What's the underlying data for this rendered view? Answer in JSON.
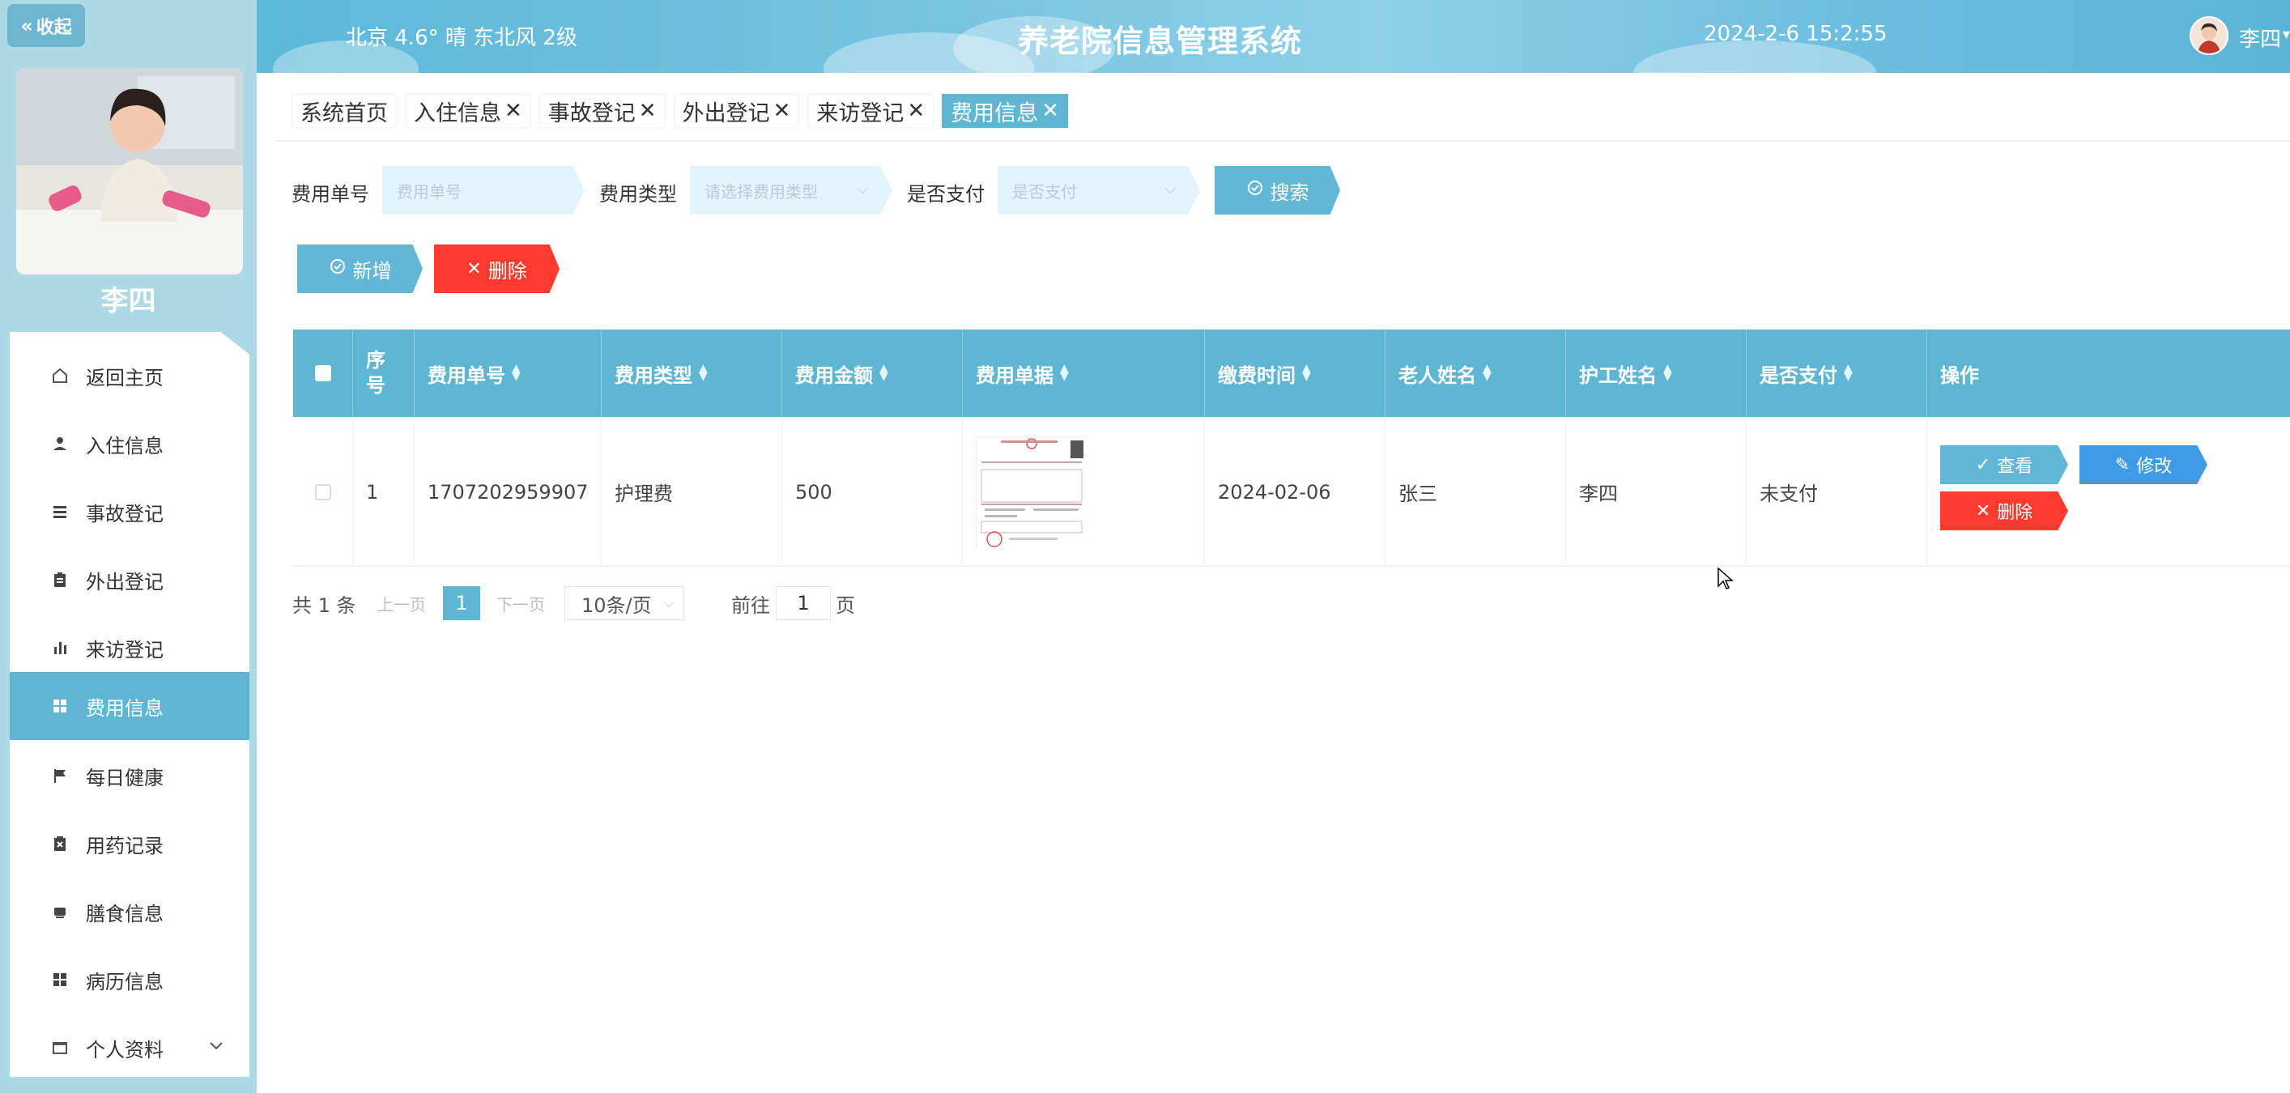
{
  "sidebar": {
    "collapse_label": "收起",
    "user_name": "李四",
    "items": [
      {
        "label": "返回主页",
        "icon": "home-icon"
      },
      {
        "label": "入住信息",
        "icon": "user-icon"
      },
      {
        "label": "事故登记",
        "icon": "list-icon"
      },
      {
        "label": "外出登记",
        "icon": "clipboard-icon"
      },
      {
        "label": "来访登记",
        "icon": "bar-chart-icon"
      },
      {
        "label": "费用信息",
        "icon": "grid-icon",
        "active": true
      },
      {
        "label": "每日健康",
        "icon": "flag-icon"
      },
      {
        "label": "用药记录",
        "icon": "medicine-icon"
      },
      {
        "label": "膳食信息",
        "icon": "meal-icon"
      },
      {
        "label": "病历信息",
        "icon": "grid-icon"
      },
      {
        "label": "个人资料",
        "icon": "wallet-icon"
      }
    ]
  },
  "header": {
    "weather": "北京 4.6° 晴 东北风 2级",
    "title": "养老院信息管理系统",
    "datetime": "2024-2-6 15:2:55",
    "user": "李四"
  },
  "tabs": [
    {
      "label": "系统首页",
      "closable": false
    },
    {
      "label": "入住信息",
      "closable": true
    },
    {
      "label": "事故登记",
      "closable": true
    },
    {
      "label": "外出登记",
      "closable": true
    },
    {
      "label": "来访登记",
      "closable": true
    },
    {
      "label": "费用信息",
      "closable": true,
      "active": true
    }
  ],
  "search": {
    "fee_no_label": "费用单号",
    "fee_no_placeholder": "费用单号",
    "fee_type_label": "费用类型",
    "fee_type_placeholder": "请选择费用类型",
    "paid_label": "是否支付",
    "paid_placeholder": "是否支付",
    "search_button": "搜索"
  },
  "actions": {
    "add_button": "新增",
    "delete_button": "删除"
  },
  "table": {
    "headers": [
      "序号",
      "费用单号",
      "费用类型",
      "费用金额",
      "费用单据",
      "缴费时间",
      "老人姓名",
      "护工姓名",
      "是否支付",
      "操作"
    ],
    "rows": [
      {
        "index": "1",
        "fee_no": "1707202959907",
        "fee_type": "护理费",
        "amount": "500",
        "paid_time": "2024-02-06",
        "elder_name": "张三",
        "caregiver_name": "李四",
        "paid": "未支付",
        "view_button": "查看",
        "edit_button": "修改",
        "delete_button": "删除"
      }
    ]
  },
  "pagination": {
    "total": "共 1 条",
    "prev": "上一页",
    "current": "1",
    "next": "下一页",
    "page_size": "10条/页",
    "goto_label": "前往",
    "goto_value": "1",
    "page_suffix": "页"
  },
  "colors": {
    "primary": "#5fb6d3",
    "danger": "#ff3b30",
    "edit": "#3d9be8",
    "sidebar_bg": "#add8e6"
  }
}
